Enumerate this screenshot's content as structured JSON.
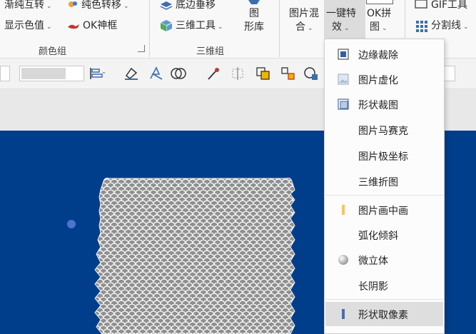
{
  "ribbon": {
    "color_group": {
      "items": [
        "渐纯互转",
        "纯色转移",
        "显示色值",
        "OK神框"
      ],
      "label": "颜色组"
    },
    "threed_group": {
      "items": [
        "底边垂移",
        "三维工具"
      ],
      "big_button_line1": "图",
      "big_button_line2": "形库",
      "label": "三维组"
    },
    "image_mix": {
      "line1": "图片混",
      "line2": "合"
    },
    "one_click": {
      "line1": "一键特",
      "line2": "效"
    },
    "ok_puzzle": {
      "line1": "OK拼",
      "line2": "图"
    },
    "gif_tool": "GIF工具",
    "split_line": "分割线"
  },
  "menu": {
    "items": [
      {
        "label": "边缘裁除",
        "icon": "frame-crop-icon"
      },
      {
        "label": "图片虚化",
        "icon": "image-blur-icon"
      },
      {
        "label": "形状裁图",
        "icon": "shape-crop-icon"
      },
      {
        "label": "图片马赛克",
        "icon": ""
      },
      {
        "label": "图片极坐标",
        "icon": ""
      },
      {
        "label": "三维折图",
        "icon": ""
      },
      {
        "label": "图片画中画",
        "icon": "picture-in-picture-icon"
      },
      {
        "label": "弧化倾斜",
        "icon": ""
      },
      {
        "label": "微立体",
        "icon": "micro-3d-icon"
      },
      {
        "label": "长阴影",
        "icon": ""
      },
      {
        "label": "形状取像素",
        "icon": "shape-pixel-icon"
      }
    ],
    "selected": "形状取像素"
  },
  "colors": {
    "slide_background": "#003e8c",
    "menu_selected": "#dedede",
    "handle": "#4a74d0"
  }
}
